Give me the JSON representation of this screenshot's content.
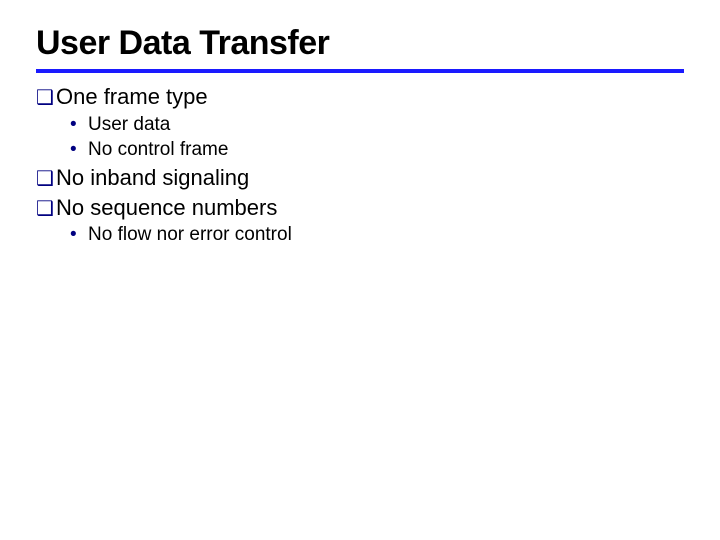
{
  "title": "User Data Transfer",
  "items": [
    {
      "level": 1,
      "text": "One frame type"
    },
    {
      "level": 2,
      "text": "User data"
    },
    {
      "level": 2,
      "text": "No control frame"
    },
    {
      "level": 1,
      "text": "No inband signaling"
    },
    {
      "level": 1,
      "text": "No sequence numbers"
    },
    {
      "level": 2,
      "text": "No flow nor error control"
    }
  ],
  "bullets": {
    "lvl1": "❑",
    "lvl2": "•"
  }
}
